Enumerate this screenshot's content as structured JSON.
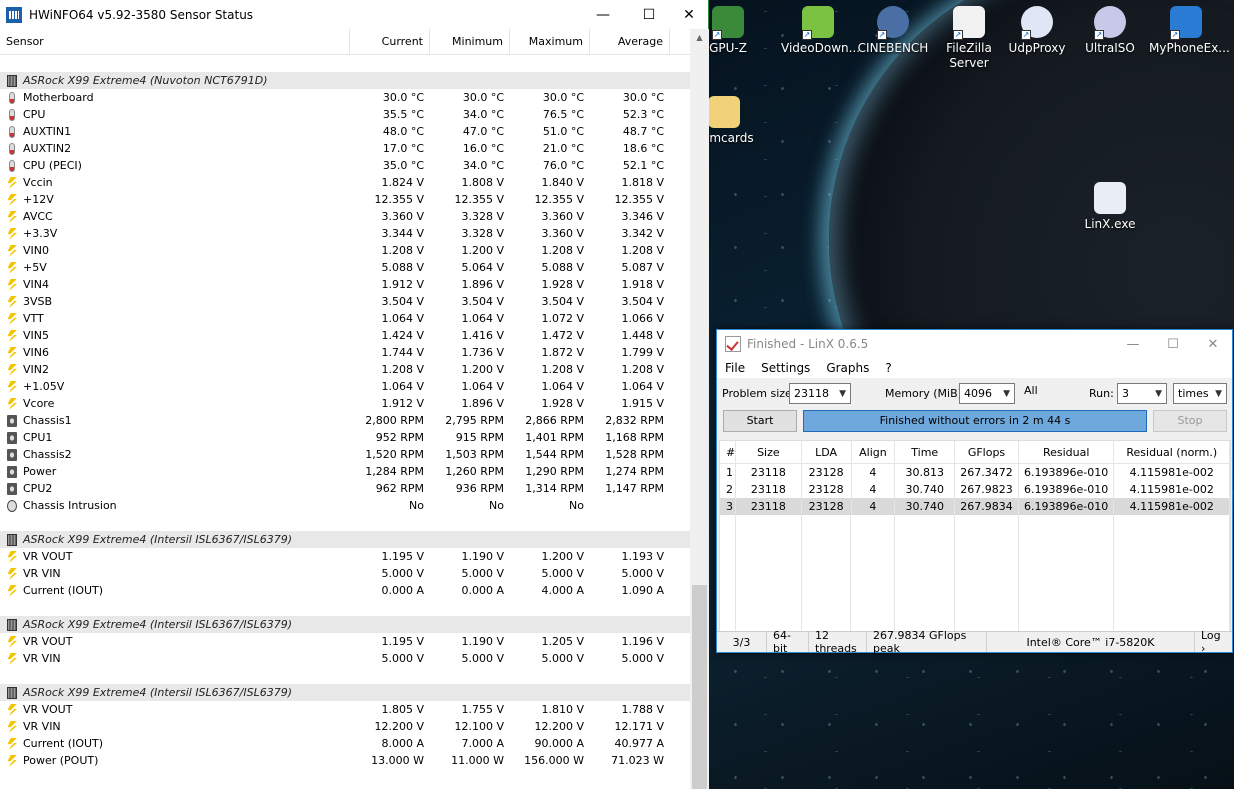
{
  "hwinfo": {
    "title": "HWiNFO64 v5.92-3580 Sensor Status",
    "columns": [
      "Sensor",
      "Current",
      "Minimum",
      "Maximum",
      "Average"
    ],
    "rows": [
      {
        "kind": "blank"
      },
      {
        "kind": "group",
        "name": "ASRock X99 Extreme4 (Nuvoton NCT6791D)"
      },
      {
        "kind": "temp",
        "name": "Motherboard",
        "cur": "30.0 °C",
        "min": "30.0 °C",
        "max": "30.0 °C",
        "avg": "30.0 °C"
      },
      {
        "kind": "temp",
        "name": "CPU",
        "cur": "35.5 °C",
        "min": "34.0 °C",
        "max": "76.5 °C",
        "avg": "52.3 °C"
      },
      {
        "kind": "temp",
        "name": "AUXTIN1",
        "cur": "48.0 °C",
        "min": "47.0 °C",
        "max": "51.0 °C",
        "avg": "48.7 °C"
      },
      {
        "kind": "temp",
        "name": "AUXTIN2",
        "cur": "17.0 °C",
        "min": "16.0 °C",
        "max": "21.0 °C",
        "avg": "18.6 °C"
      },
      {
        "kind": "temp",
        "name": "CPU (PECI)",
        "cur": "35.0 °C",
        "min": "34.0 °C",
        "max": "76.0 °C",
        "avg": "52.1 °C"
      },
      {
        "kind": "volt",
        "name": "Vccin",
        "cur": "1.824 V",
        "min": "1.808 V",
        "max": "1.840 V",
        "avg": "1.818 V"
      },
      {
        "kind": "volt",
        "name": "+12V",
        "cur": "12.355 V",
        "min": "12.355 V",
        "max": "12.355 V",
        "avg": "12.355 V"
      },
      {
        "kind": "volt",
        "name": "AVCC",
        "cur": "3.360 V",
        "min": "3.328 V",
        "max": "3.360 V",
        "avg": "3.346 V"
      },
      {
        "kind": "volt",
        "name": "+3.3V",
        "cur": "3.344 V",
        "min": "3.328 V",
        "max": "3.360 V",
        "avg": "3.342 V"
      },
      {
        "kind": "volt",
        "name": "VIN0",
        "cur": "1.208 V",
        "min": "1.200 V",
        "max": "1.208 V",
        "avg": "1.208 V"
      },
      {
        "kind": "volt",
        "name": "+5V",
        "cur": "5.088 V",
        "min": "5.064 V",
        "max": "5.088 V",
        "avg": "5.087 V"
      },
      {
        "kind": "volt",
        "name": "VIN4",
        "cur": "1.912 V",
        "min": "1.896 V",
        "max": "1.928 V",
        "avg": "1.918 V"
      },
      {
        "kind": "volt",
        "name": "3VSB",
        "cur": "3.504 V",
        "min": "3.504 V",
        "max": "3.504 V",
        "avg": "3.504 V"
      },
      {
        "kind": "volt",
        "name": "VTT",
        "cur": "1.064 V",
        "min": "1.064 V",
        "max": "1.072 V",
        "avg": "1.066 V"
      },
      {
        "kind": "volt",
        "name": "VIN5",
        "cur": "1.424 V",
        "min": "1.416 V",
        "max": "1.472 V",
        "avg": "1.448 V"
      },
      {
        "kind": "volt",
        "name": "VIN6",
        "cur": "1.744 V",
        "min": "1.736 V",
        "max": "1.872 V",
        "avg": "1.799 V"
      },
      {
        "kind": "volt",
        "name": "VIN2",
        "cur": "1.208 V",
        "min": "1.200 V",
        "max": "1.208 V",
        "avg": "1.208 V"
      },
      {
        "kind": "volt",
        "name": "+1.05V",
        "cur": "1.064 V",
        "min": "1.064 V",
        "max": "1.064 V",
        "avg": "1.064 V"
      },
      {
        "kind": "volt",
        "name": "Vcore",
        "cur": "1.912 V",
        "min": "1.896 V",
        "max": "1.928 V",
        "avg": "1.915 V"
      },
      {
        "kind": "fan",
        "name": "Chassis1",
        "cur": "2,800 RPM",
        "min": "2,795 RPM",
        "max": "2,866 RPM",
        "avg": "2,832 RPM"
      },
      {
        "kind": "fan",
        "name": "CPU1",
        "cur": "952 RPM",
        "min": "915 RPM",
        "max": "1,401 RPM",
        "avg": "1,168 RPM"
      },
      {
        "kind": "fan",
        "name": "Chassis2",
        "cur": "1,520 RPM",
        "min": "1,503 RPM",
        "max": "1,544 RPM",
        "avg": "1,528 RPM"
      },
      {
        "kind": "fan",
        "name": "Power",
        "cur": "1,284 RPM",
        "min": "1,260 RPM",
        "max": "1,290 RPM",
        "avg": "1,274 RPM"
      },
      {
        "kind": "fan",
        "name": "CPU2",
        "cur": "962 RPM",
        "min": "936 RPM",
        "max": "1,314 RPM",
        "avg": "1,147 RPM"
      },
      {
        "kind": "intr",
        "name": "Chassis Intrusion",
        "cur": "No",
        "min": "No",
        "max": "No",
        "avg": ""
      },
      {
        "kind": "blank"
      },
      {
        "kind": "group",
        "name": "ASRock X99 Extreme4 (Intersil ISL6367/ISL6379)"
      },
      {
        "kind": "volt",
        "name": "VR VOUT",
        "cur": "1.195 V",
        "min": "1.190 V",
        "max": "1.200 V",
        "avg": "1.193 V"
      },
      {
        "kind": "volt",
        "name": "VR VIN",
        "cur": "5.000 V",
        "min": "5.000 V",
        "max": "5.000 V",
        "avg": "5.000 V"
      },
      {
        "kind": "volt",
        "name": "Current (IOUT)",
        "cur": "0.000 A",
        "min": "0.000 A",
        "max": "4.000 A",
        "avg": "1.090 A"
      },
      {
        "kind": "blank"
      },
      {
        "kind": "group",
        "name": "ASRock X99 Extreme4 (Intersil ISL6367/ISL6379)"
      },
      {
        "kind": "volt",
        "name": "VR VOUT",
        "cur": "1.195 V",
        "min": "1.190 V",
        "max": "1.205 V",
        "avg": "1.196 V"
      },
      {
        "kind": "volt",
        "name": "VR VIN",
        "cur": "5.000 V",
        "min": "5.000 V",
        "max": "5.000 V",
        "avg": "5.000 V"
      },
      {
        "kind": "blank"
      },
      {
        "kind": "group",
        "name": "ASRock X99 Extreme4 (Intersil ISL6367/ISL6379)"
      },
      {
        "kind": "volt",
        "name": "VR VOUT",
        "cur": "1.805 V",
        "min": "1.755 V",
        "max": "1.810 V",
        "avg": "1.788 V"
      },
      {
        "kind": "volt",
        "name": "VR VIN",
        "cur": "12.200 V",
        "min": "12.100 V",
        "max": "12.200 V",
        "avg": "12.171 V"
      },
      {
        "kind": "volt",
        "name": "Current (IOUT)",
        "cur": "8.000 A",
        "min": "7.000 A",
        "max": "90.000 A",
        "avg": "40.977 A"
      },
      {
        "kind": "volt",
        "name": "Power (POUT)",
        "cur": "13.000 W",
        "min": "11.000 W",
        "max": "156.000 W",
        "avg": "71.023 W"
      }
    ]
  },
  "desktop": {
    "icons": [
      {
        "label": "GPU-Z",
        "icon": "gpuz-icon",
        "color": "#3a8a3a"
      },
      {
        "label": "VideoDown...",
        "icon": "video-downloader-icon",
        "color": "#7cc242"
      },
      {
        "label": "CINEBENCH",
        "icon": "cinebench-icon",
        "color": "#4a6fa5"
      },
      {
        "label": "FileZilla Server",
        "icon": "filezilla-icon",
        "color": "#f2f2f2"
      },
      {
        "label": "UdpProxy",
        "icon": "disc-icon",
        "color": "#dfe6f5"
      },
      {
        "label": "UltraISO",
        "icon": "ultraiso-icon",
        "color": "#c8c8e8"
      },
      {
        "label": "MyPhoneEx...",
        "icon": "myphone-icon",
        "color": "#2a7bd4"
      },
      {
        "label": "hemcards",
        "icon": "folder-icon",
        "color": "#f1d27a"
      },
      {
        "label": "LinX.exe",
        "icon": "linx-icon",
        "color": "#e8eef4"
      }
    ]
  },
  "linx": {
    "title": "Finished - LinX 0.6.5",
    "menu": [
      "File",
      "Settings",
      "Graphs",
      "?"
    ],
    "problem_size_label": "Problem size:",
    "problem_size": "23118",
    "memory_label": "Memory (MiB):",
    "memory": "4096",
    "all_label": "All",
    "run_label": "Run:",
    "run": "3",
    "run_unit": "times",
    "start_label": "Start",
    "stop_label": "Stop",
    "progress_text": "Finished without errors in 2 m 44 s",
    "table_headers": [
      "#",
      "Size",
      "LDA",
      "Align",
      "Time",
      "GFlops",
      "Residual",
      "Residual (norm.)"
    ],
    "table_rows": [
      [
        "1",
        "23118",
        "23128",
        "4",
        "30.813",
        "267.3472",
        "6.193896e-010",
        "4.115981e-002"
      ],
      [
        "2",
        "23118",
        "23128",
        "4",
        "30.740",
        "267.9823",
        "6.193896e-010",
        "4.115981e-002"
      ],
      [
        "3",
        "23118",
        "23128",
        "4",
        "30.740",
        "267.9834",
        "6.193896e-010",
        "4.115981e-002"
      ]
    ],
    "status": [
      "3/3",
      "64-bit",
      "12 threads",
      "267.9834 GFlops peak",
      "Intel® Core™ i7-5820K",
      "Log ›"
    ]
  }
}
